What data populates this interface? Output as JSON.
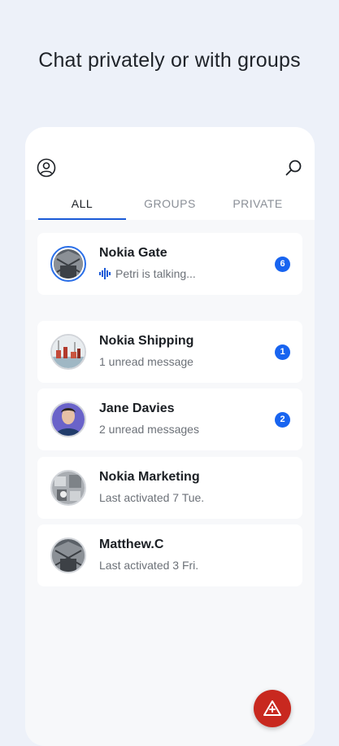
{
  "headline": "Chat privately or with groups",
  "tabs": [
    {
      "label": "ALL",
      "active": true
    },
    {
      "label": "GROUPS",
      "active": false
    },
    {
      "label": "PRIVATE",
      "active": false
    }
  ],
  "conversations": [
    {
      "name": "Nokia Gate",
      "subtitle": "Petri is talking...",
      "badge": "6",
      "status": "talking"
    },
    {
      "name": "Nokia Shipping",
      "subtitle": "1 unread message",
      "badge": "1"
    },
    {
      "name": "Jane Davies",
      "subtitle": "2 unread messages",
      "badge": "2"
    },
    {
      "name": "Nokia Marketing",
      "subtitle": "Last activated 7 Tue."
    },
    {
      "name": "Matthew.C",
      "subtitle": "Last activated 3 Fri."
    }
  ],
  "icons": {
    "profile": "profile-icon",
    "search": "search-icon",
    "voice": "voice-wave-icon",
    "fab": "alert-triangle-icon"
  },
  "colors": {
    "accent": "#1a5ad7",
    "badge": "#1864f0",
    "fab": "#c8281f"
  }
}
